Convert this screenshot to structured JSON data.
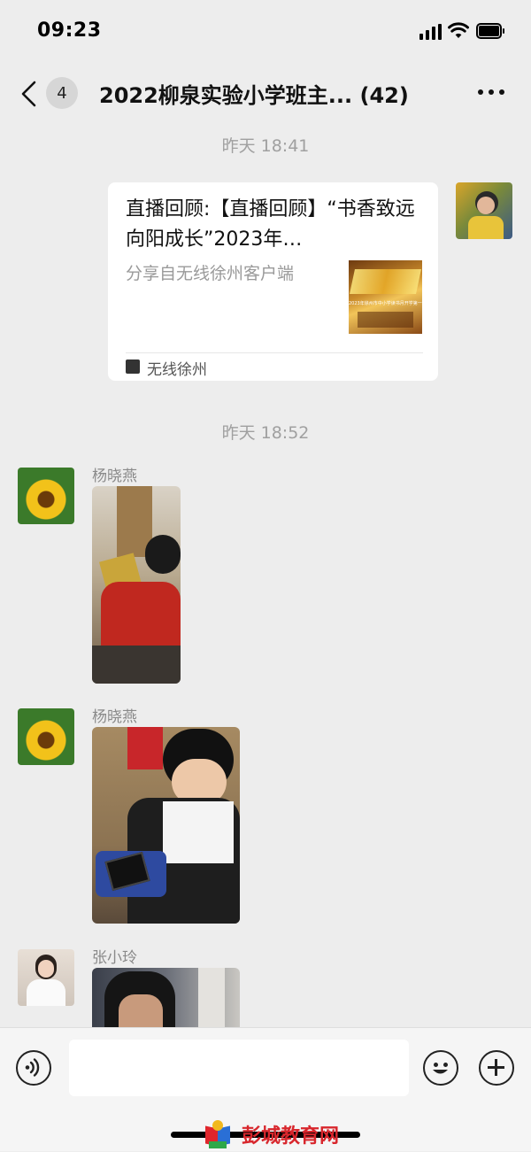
{
  "status_bar": {
    "time": "09:23"
  },
  "nav": {
    "back_count": "4",
    "title": "2022柳泉实验小学班主... (42)"
  },
  "messages": {
    "time_1": "昨天 18:41",
    "link_card": {
      "title": "直播回顾:【直播回顾】“书香致远 向阳成长”2023年…",
      "description": "分享自无线徐州客户端",
      "thumb_caption": "2023年徐州市中小学读书月开学第一课",
      "source": "无线徐州"
    },
    "time_2": "昨天 18:52",
    "sender_1": "杨晓燕",
    "sender_2": "杨晓燕",
    "sender_3": "张小玲"
  },
  "watermark": "彭城教育网",
  "colors": {
    "background": "#ededed",
    "card": "#ffffff",
    "watermark": "#d8262c"
  }
}
